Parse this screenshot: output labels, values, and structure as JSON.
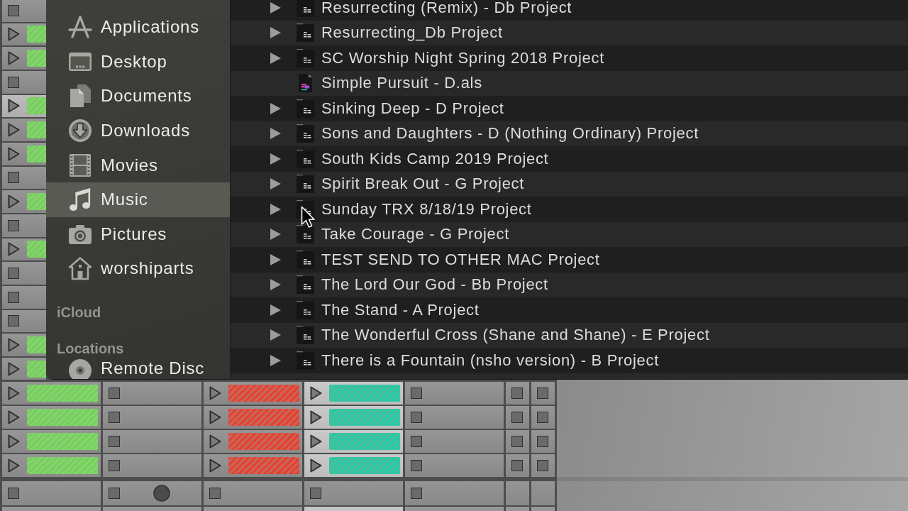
{
  "clip_column": {
    "slots": [
      {
        "kind": "empty",
        "selected": false
      },
      {
        "kind": "clip",
        "selected": false
      },
      {
        "kind": "clip",
        "selected": false
      },
      {
        "kind": "empty",
        "selected": false
      },
      {
        "kind": "clip",
        "selected": true
      },
      {
        "kind": "clip",
        "selected": false
      },
      {
        "kind": "clip",
        "selected": false
      },
      {
        "kind": "empty",
        "selected": false
      },
      {
        "kind": "clip",
        "selected": false
      },
      {
        "kind": "empty",
        "selected": false
      },
      {
        "kind": "clip",
        "selected": false
      },
      {
        "kind": "empty",
        "selected": false
      },
      {
        "kind": "empty",
        "selected": false
      },
      {
        "kind": "empty",
        "selected": false
      },
      {
        "kind": "clip",
        "selected": false
      },
      {
        "kind": "clip",
        "selected": false
      }
    ]
  },
  "finder": {
    "sidebar": {
      "items": [
        {
          "label": "Applications",
          "selected": false
        },
        {
          "label": "Desktop",
          "selected": false
        },
        {
          "label": "Documents",
          "selected": false
        },
        {
          "label": "Downloads",
          "selected": false
        },
        {
          "label": "Movies",
          "selected": false
        },
        {
          "label": "Music",
          "selected": true
        },
        {
          "label": "Pictures",
          "selected": false
        },
        {
          "label": "worshiparts",
          "selected": false
        }
      ],
      "sections": [
        {
          "title": "iCloud"
        },
        {
          "title": "Locations",
          "items": [
            {
              "label": "Remote Disc",
              "selected": false
            }
          ]
        }
      ]
    },
    "files": [
      {
        "name": "Resurrecting (Remix) - Db Project",
        "kind": "folder",
        "expanded": false
      },
      {
        "name": "Resurrecting_Db Project",
        "kind": "folder",
        "expanded": false
      },
      {
        "name": "SC Worship Night Spring 2018 Project",
        "kind": "folder",
        "expanded": false
      },
      {
        "name": "Simple Pursuit - D.als",
        "kind": "file"
      },
      {
        "name": "Sinking Deep - D Project",
        "kind": "folder",
        "expanded": false
      },
      {
        "name": "Sons and Daughters - D (Nothing Ordinary) Project",
        "kind": "folder",
        "expanded": false
      },
      {
        "name": "South Kids Camp 2019 Project",
        "kind": "folder",
        "expanded": false
      },
      {
        "name": "Spirit Break Out - G Project",
        "kind": "folder",
        "expanded": false
      },
      {
        "name": "Sunday TRX 8/18/19 Project",
        "kind": "folder",
        "expanded": false
      },
      {
        "name": "Take Courage - G Project",
        "kind": "folder",
        "expanded": false
      },
      {
        "name": "TEST SEND TO OTHER MAC Project",
        "kind": "folder",
        "expanded": false
      },
      {
        "name": "The Lord Our God - Bb Project",
        "kind": "folder",
        "expanded": false
      },
      {
        "name": "The Stand - A Project",
        "kind": "folder",
        "expanded": false
      },
      {
        "name": "The Wonderful Cross (Shane and Shane) - E Project",
        "kind": "folder",
        "expanded": false
      },
      {
        "name": "There is a Fountain (nsho version) - B Project",
        "kind": "folder",
        "expanded": false
      }
    ]
  },
  "clip_grid": {
    "tracks": [
      {
        "kind": "full",
        "color": "#76e058",
        "selected": false,
        "slots": [
          {
            "kind": "clip"
          },
          {
            "kind": "clip"
          },
          {
            "kind": "clip"
          },
          {
            "kind": "clip"
          }
        ],
        "stop_button": true,
        "circle": false
      },
      {
        "kind": "full",
        "selected": false,
        "slots": [
          {
            "kind": "empty"
          },
          {
            "kind": "empty"
          },
          {
            "kind": "empty"
          },
          {
            "kind": "empty"
          }
        ],
        "stop_button": true,
        "circle": true
      },
      {
        "kind": "full",
        "color": "#e8402e",
        "selected": false,
        "slots": [
          {
            "kind": "clip"
          },
          {
            "kind": "clip"
          },
          {
            "kind": "clip"
          },
          {
            "kind": "clip"
          }
        ],
        "stop_button": true,
        "circle": false
      },
      {
        "kind": "full",
        "color": "#1ecfa5",
        "selected": true,
        "slots": [
          {
            "kind": "clip"
          },
          {
            "kind": "clip"
          },
          {
            "kind": "clip"
          },
          {
            "kind": "clip"
          }
        ],
        "stop_button": true,
        "circle": false
      },
      {
        "kind": "full",
        "selected": false,
        "slots": [
          {
            "kind": "empty"
          },
          {
            "kind": "empty"
          },
          {
            "kind": "empty"
          },
          {
            "kind": "empty"
          }
        ],
        "stop_button": true,
        "circle": false
      },
      {
        "kind": "narrow",
        "selected": false,
        "slots": [
          {
            "kind": "empty"
          },
          {
            "kind": "empty"
          },
          {
            "kind": "empty"
          },
          {
            "kind": "empty"
          }
        ],
        "stop_button": false,
        "circle": false
      },
      {
        "kind": "narrow",
        "selected": false,
        "slots": [
          {
            "kind": "empty"
          },
          {
            "kind": "empty"
          },
          {
            "kind": "empty"
          },
          {
            "kind": "empty"
          }
        ],
        "stop_button": false,
        "circle": false
      }
    ]
  }
}
